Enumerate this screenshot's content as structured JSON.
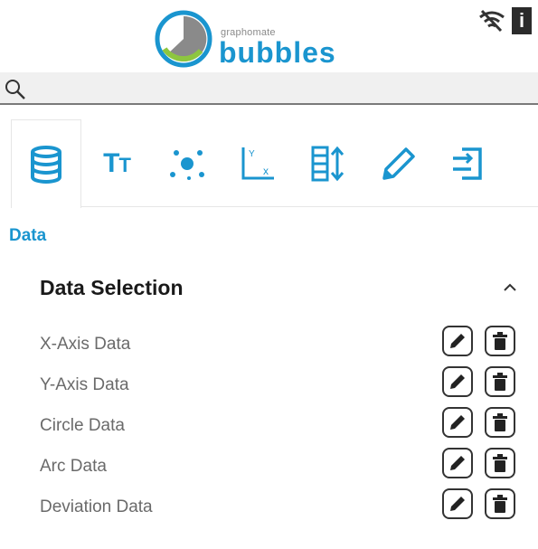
{
  "header": {
    "logo_small": "graphomate",
    "logo_big": "bubbles",
    "info_label": "i"
  },
  "search": {
    "value": "",
    "placeholder": ""
  },
  "tabs": [
    {
      "name": "data",
      "icon": "database-icon",
      "active": true
    },
    {
      "name": "text",
      "icon": "text-size-icon",
      "label_big": "T",
      "label_small": "T"
    },
    {
      "name": "bubbles",
      "icon": "scatter-icon"
    },
    {
      "name": "axes",
      "icon": "axes-icon"
    },
    {
      "name": "sort",
      "icon": "sort-icon"
    },
    {
      "name": "style",
      "icon": "pencil-icon"
    },
    {
      "name": "export",
      "icon": "export-icon"
    }
  ],
  "section": {
    "title": "Data"
  },
  "group": {
    "title": "Data Selection",
    "expanded": true,
    "rows": [
      {
        "label": "X-Axis Data"
      },
      {
        "label": "Y-Axis Data"
      },
      {
        "label": "Circle Data"
      },
      {
        "label": "Arc Data"
      },
      {
        "label": "Deviation Data"
      }
    ]
  },
  "colors": {
    "accent": "#1a95cf",
    "logo_green": "#8dc63f",
    "logo_grey": "#8a8a8a"
  }
}
